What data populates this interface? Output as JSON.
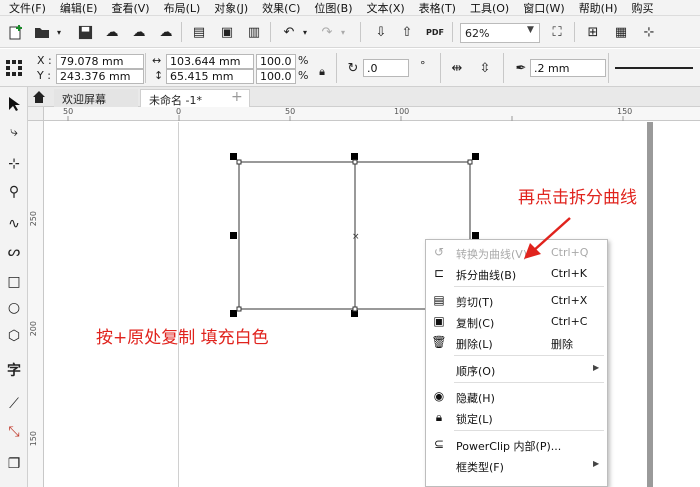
{
  "menu": [
    "文件(F)",
    "编辑(E)",
    "查看(V)",
    "布局(L)",
    "对象(J)",
    "效果(C)",
    "位图(B)",
    "文本(X)",
    "表格(T)",
    "工具(O)",
    "窗口(W)",
    "帮助(H)",
    "购买"
  ],
  "toolbar": {
    "zoom": "62%",
    "icons": [
      "new-document-icon",
      "open-folder-icon",
      "save-icon",
      "import-icon",
      "export-icon",
      "cut-icon",
      "copy-icon",
      "paste-icon",
      "undo-icon",
      "redo-icon",
      "pdf-icon",
      "full-screen-icon",
      "rulers-icon",
      "grid-icon",
      "guidelines-icon"
    ]
  },
  "property_bar": {
    "x_label": "X :",
    "x_value": "79.078 mm",
    "y_label": "Y :",
    "y_value": "243.376 mm",
    "width": "103.644 mm",
    "height": "65.415 mm",
    "scale_w": "100.0",
    "scale_h": "100.0",
    "pct": "%",
    "rotation": ".0",
    "degree": "°",
    "outline_width": ".2 mm"
  },
  "tabs": {
    "welcome": "欢迎屏幕",
    "document": "未命名 -1*",
    "add": "+"
  },
  "ruler": {
    "top_ticks": [
      "50",
      "0",
      "50",
      "100",
      "150"
    ],
    "left_ticks": [
      "250",
      "200",
      "150"
    ]
  },
  "context_menu": [
    {
      "label": "转换为曲线(V)",
      "shortcut": "Ctrl+Q",
      "icon": "convert-to-curves-icon",
      "disabled": true
    },
    {
      "label": "拆分曲线(B)",
      "shortcut": "Ctrl+K",
      "icon": "break-apart-icon"
    },
    {
      "label": "剪切(T)",
      "shortcut": "Ctrl+X",
      "icon": "cut-icon"
    },
    {
      "label": "复制(C)",
      "shortcut": "Ctrl+C",
      "icon": "copy-icon"
    },
    {
      "label": "删除(L)",
      "shortcut": "删除",
      "icon": "delete-icon"
    },
    {
      "label": "顺序(O)",
      "shortcut": "",
      "icon": "",
      "submenu": true
    },
    {
      "label": "隐藏(H)",
      "shortcut": "",
      "icon": "hide-icon"
    },
    {
      "label": "锁定(L)",
      "shortcut": "",
      "icon": "lock-icon"
    },
    {
      "label": "PowerClip 内部(P)...",
      "shortcut": "",
      "icon": "powerclip-icon"
    },
    {
      "label": "框类型(F)",
      "shortcut": "",
      "icon": "",
      "submenu": true
    }
  ],
  "annotations": {
    "top_right": "再点击拆分曲线",
    "left": "按+原处复制  填充白色"
  },
  "colors": {
    "annotation": "#e0231d",
    "selection_handle": "#000000"
  }
}
